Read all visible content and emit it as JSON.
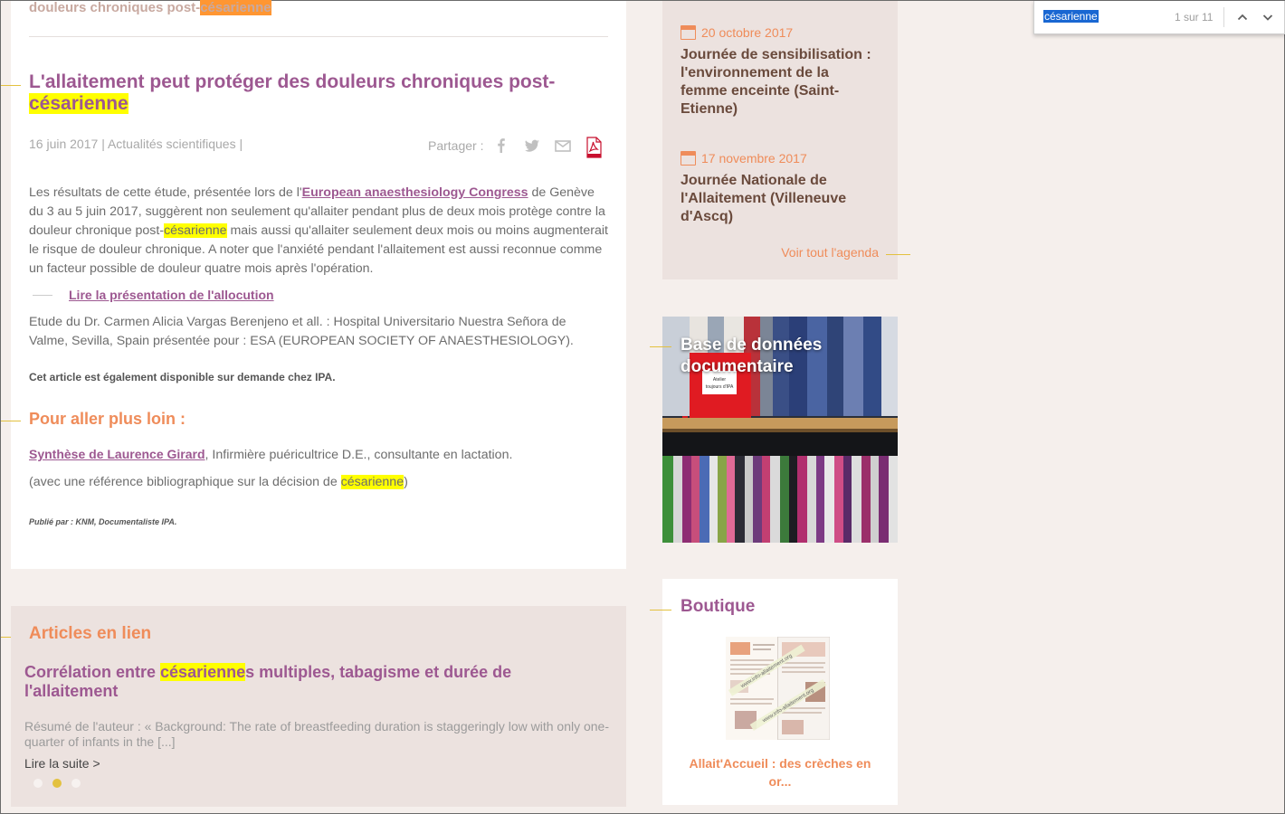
{
  "article": {
    "prev_title_text": "douleurs chroniques post-",
    "prev_title_hl": "césarienne",
    "title_text": "L'allaitement peut protéger des douleurs chroniques post-",
    "title_hl": "césarienne",
    "date": "16 juin 2017",
    "category": "Actualités scientifiques",
    "meta_sep": "|",
    "share_label": "Partager :",
    "body_p1_a": "Les résultats de cette étude, présentée lors de l'",
    "body_link": "European anaesthesiology Congress",
    "body_p1_b": " de Genève du 3 au 5 juin 2017, suggèrent non seulement qu'allaiter pendant plus de deux mois protège contre la douleur chronique post-",
    "body_hl": "césarienne",
    "body_p1_c": " mais aussi qu'allaiter seulement deux mois ou moins augmenterait le risque de douleur chronique. A noter que l'anxiété pendant l'allaitement est aussi reconnue comme un facteur possible de douleur quatre mois après l'opération.",
    "read_link": "Lire la présentation de l'allocution",
    "study": "Etude du Dr. Carmen Alicia Vargas Berenjeno et all. : Hospital Universitario Nuestra Señora de Valme, Sevilla, Spain  présentée pour : ESA (EUROPEAN SOCIETY OF ANAESTHESIOLOGY).",
    "note": "Cet article est également disponible sur demande chez IPA.",
    "further_title": "Pour aller plus loin :",
    "synth_link": "Synthèse de Laurence Girard",
    "synth_rest": ",  Infirmière puéricultrice D.E., consultante en lactation.",
    "ref_a": "(avec une référence bibliographique sur la décision de ",
    "ref_hl": "césarienne",
    "ref_b": ")",
    "author": "Publié par : KNM, Documentaliste IPA."
  },
  "related": {
    "title": "Articles en lien",
    "article_title_a": "Corrélation entre ",
    "article_title_hl": "césarienne",
    "article_title_b": "s multiples, tabagisme et durée de l'allaitement",
    "excerpt": "Résumé de l'auteur : « Background: The rate of breastfeeding duration is staggeringly low with only one-quarter of infants in the [...]",
    "more": "Lire la suite >",
    "active_dot": 1,
    "dot_count": 3
  },
  "agenda": {
    "events": [
      {
        "date": "20 octobre 2017",
        "title": "Journée de sensibilisation : l'environnement de la femme enceinte (Saint-Etienne)"
      },
      {
        "date": "17 novembre 2017",
        "title": "Journée Nationale de l'Allaitement (Villeneuve d'Ascq)"
      }
    ],
    "all_link": "Voir tout l'agenda"
  },
  "database": {
    "title": "Base de données documentaire",
    "sign_text": "Atelier toujours d'IPA"
  },
  "boutique": {
    "title": "Boutique",
    "product": "Allait'Accueil : des crèches en or...",
    "product_watermark": "www.info-allaitement.org"
  },
  "findbar": {
    "query": "césarienne",
    "count": "1 sur 11"
  },
  "colors": {
    "accent_purple": "#9d5891",
    "accent_orange": "#ef8c5a",
    "deco_yellow": "#e3c13f",
    "highlight": "#ffff00",
    "highlight_current": "#ff9632"
  },
  "icons": [
    "facebook-icon",
    "twitter-icon",
    "mail-icon",
    "pdf-icon",
    "calendar-icon",
    "chevron-up-icon",
    "chevron-down-icon"
  ]
}
